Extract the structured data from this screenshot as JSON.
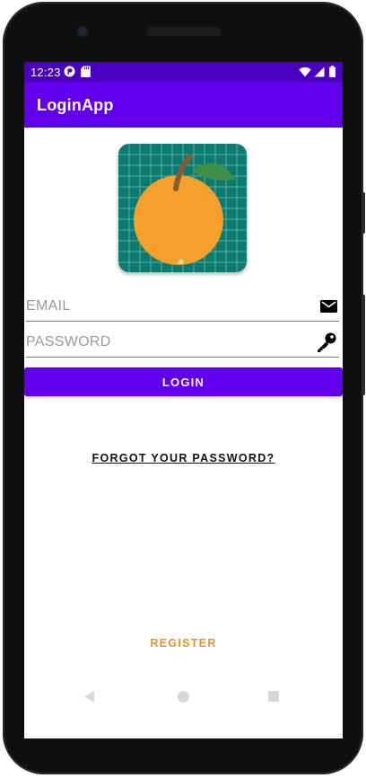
{
  "status_bar": {
    "time": "12:23"
  },
  "app_bar": {
    "title": "LoginApp"
  },
  "form": {
    "email_placeholder": "EMAIL",
    "email_value": "",
    "password_placeholder": "PASSWORD",
    "password_value": "",
    "login_label": "LOGIN",
    "forgot_label": "FORGOT YOUR PASSWORD?",
    "register_label": "REGISTER"
  },
  "icons": {
    "email": "envelope-icon",
    "password": "key-icon",
    "nav_back": "back-triangle-icon",
    "nav_home": "home-circle-icon",
    "nav_recents": "recents-square-icon"
  },
  "colors": {
    "primary": "#6200ee",
    "primary_dark": "#4a00c0",
    "accent": "#f2911b",
    "logo_background": "#0d7a6f",
    "logo_fruit": "#f5a02c"
  }
}
